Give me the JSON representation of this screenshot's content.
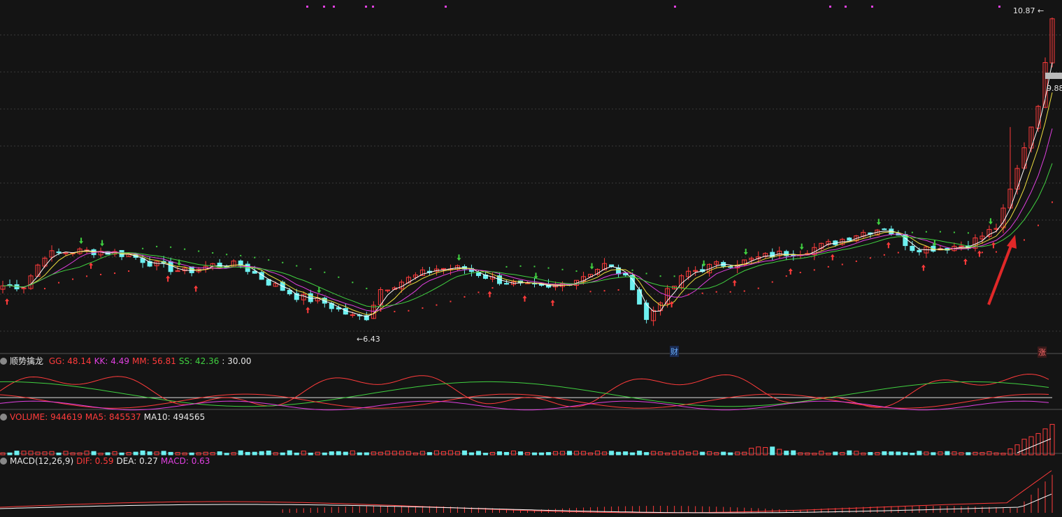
{
  "colors": {
    "bg": "#141414",
    "up": "#ff3b3b",
    "down": "#6df0f0",
    "ma_white": "#ffffff",
    "ma_yellow": "#f0e040",
    "ma_magenta": "#e040e0",
    "ma_green": "#40d040",
    "grid": "#3a3a3a",
    "separator": "#555555"
  },
  "price_panel": {
    "high_label": "10.87",
    "current_price": "9.88",
    "low_label": "6.43",
    "marker_cai": "财",
    "marker_zhang": "涨"
  },
  "indicator_panel": {
    "name": "顺势擒龙",
    "legend": [
      {
        "text": "GG: 48.14",
        "color": "#ff3b3b"
      },
      {
        "text": "KK: 4.49",
        "color": "#e040e0"
      },
      {
        "text": "MM: 56.81",
        "color": "#ff3b3b"
      },
      {
        "text": "SS: 42.36",
        "color": "#40d040"
      },
      {
        "text": ": 30.00",
        "color": "#e6e6e6"
      }
    ]
  },
  "volume_panel": {
    "legend": [
      {
        "text": "VOLUME: 944619",
        "color": "#ff3b3b"
      },
      {
        "text": "MA5: 845537",
        "color": "#ff3b3b"
      },
      {
        "text": "MA10: 494565",
        "color": "#e6e6e6"
      }
    ]
  },
  "macd_panel": {
    "legend": [
      {
        "text": "MACD(12,26,9)",
        "color": "#e6e6e6"
      },
      {
        "text": "DIF: 0.59",
        "color": "#ff3b3b"
      },
      {
        "text": "DEA: 0.27",
        "color": "#e6e6e6"
      },
      {
        "text": "MACD: 0.63",
        "color": "#e040e0"
      }
    ]
  },
  "chart_data": {
    "type": "candlestick",
    "ylim": [
      6.2,
      11.0
    ],
    "closes_keypoints": [
      [
        0,
        7.0
      ],
      [
        3,
        7.0
      ],
      [
        6,
        7.45
      ],
      [
        10,
        7.5
      ],
      [
        14,
        7.5
      ],
      [
        18,
        7.45
      ],
      [
        22,
        7.3
      ],
      [
        26,
        7.2
      ],
      [
        30,
        7.3
      ],
      [
        34,
        7.3
      ],
      [
        38,
        7.05
      ],
      [
        42,
        6.85
      ],
      [
        46,
        6.75
      ],
      [
        50,
        6.55
      ],
      [
        52,
        6.55
      ],
      [
        54,
        6.95
      ],
      [
        58,
        7.1
      ],
      [
        62,
        7.25
      ],
      [
        66,
        7.25
      ],
      [
        70,
        7.1
      ],
      [
        74,
        7.0
      ],
      [
        78,
        6.95
      ],
      [
        82,
        7.1
      ],
      [
        86,
        7.3
      ],
      [
        88,
        7.2
      ],
      [
        90,
        7.0
      ],
      [
        92,
        6.5
      ],
      [
        94,
        6.8
      ],
      [
        98,
        7.2
      ],
      [
        102,
        7.3
      ],
      [
        106,
        7.35
      ],
      [
        110,
        7.45
      ],
      [
        114,
        7.5
      ],
      [
        118,
        7.6
      ],
      [
        122,
        7.75
      ],
      [
        126,
        7.85
      ],
      [
        128,
        7.7
      ],
      [
        130,
        7.55
      ],
      [
        134,
        7.55
      ],
      [
        138,
        7.6
      ],
      [
        142,
        7.85
      ],
      [
        144,
        8.4
      ],
      [
        146,
        9.0
      ],
      [
        148,
        9.6
      ],
      [
        150,
        10.87
      ]
    ]
  }
}
